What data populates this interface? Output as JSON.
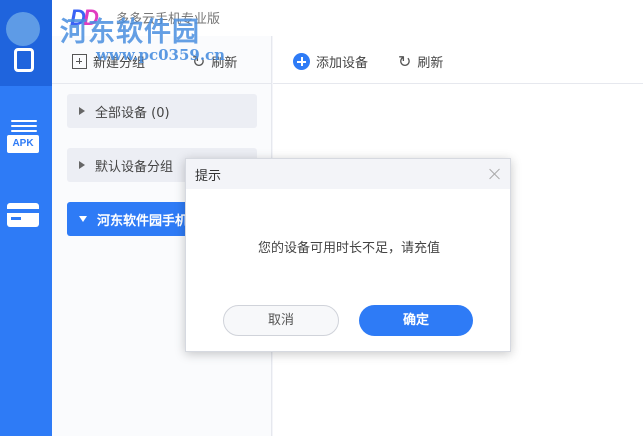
{
  "app": {
    "title": "多多云手机专业版",
    "logo_text": "DD"
  },
  "watermark": {
    "text": "河东软件园",
    "url": "www.pc0359.cn"
  },
  "sidebar": {
    "items": [
      {
        "name": "phone",
        "icon": "phone-icon"
      },
      {
        "name": "apk",
        "icon": "apk-icon",
        "label": "APK"
      },
      {
        "name": "card",
        "icon": "card-icon"
      }
    ]
  },
  "group_panel": {
    "new_group_label": "新建分组",
    "refresh_label": "刷新",
    "groups": [
      {
        "label": "全部设备 (0)",
        "expanded": false
      },
      {
        "label": "默认设备分组",
        "expanded": false
      },
      {
        "label": "河东软件园手机",
        "expanded": true
      }
    ]
  },
  "main": {
    "add_device_label": "添加设备",
    "refresh_label": "刷新"
  },
  "dialog": {
    "title": "提示",
    "message": "您的设备可用时长不足，请充值",
    "cancel_label": "取消",
    "ok_label": "确定"
  },
  "colors": {
    "accent": "#2e7bf6",
    "rail_dark": "#1f64dd"
  }
}
